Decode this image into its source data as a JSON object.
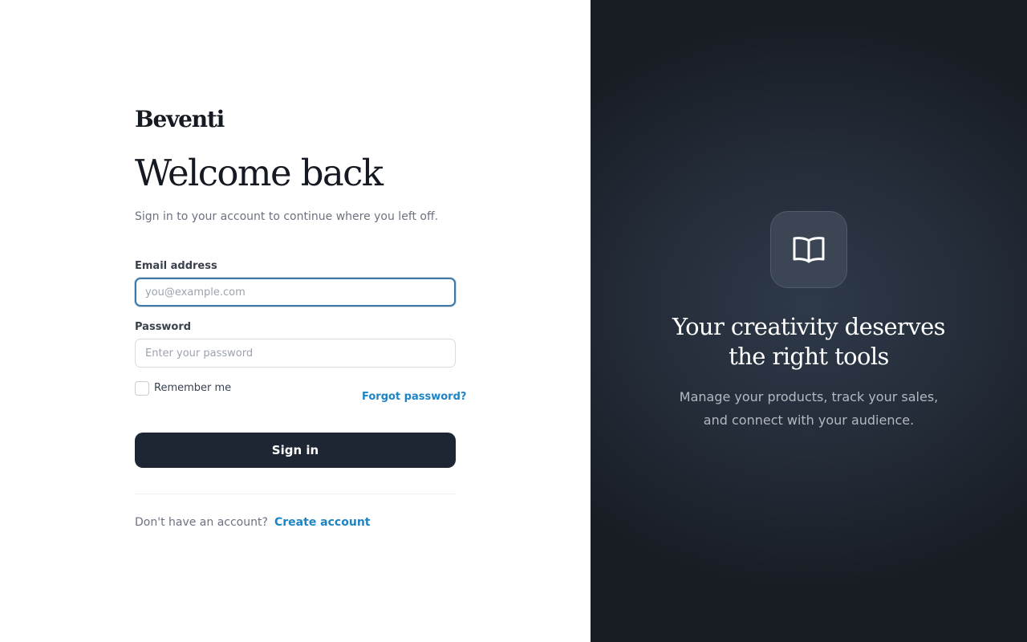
{
  "brand": {
    "logo_text": "Beventi"
  },
  "login": {
    "title": "Welcome back",
    "subtitle": "Sign in to your account to continue where you left off.",
    "email": {
      "label": "Email address",
      "placeholder": "you@example.com",
      "value": ""
    },
    "password": {
      "label": "Password",
      "placeholder": "Enter your password",
      "value": ""
    },
    "remember_label": "Remember me",
    "remember_checked": false,
    "forgot_label": "Forgot password?",
    "signin_label": "Sign in",
    "no_account_text": "Don't have an account?",
    "create_label": "Create account"
  },
  "hero": {
    "icon": "open-book-icon",
    "title_line1": "Your creativity deserves",
    "title_line2": "the right tools",
    "subtitle_line1": "Manage your products, track your sales,",
    "subtitle_line2": "and connect with your audience."
  },
  "colors": {
    "primary_button": "#1e2633",
    "link": "#1d84c6",
    "focus_border": "#3f78a4",
    "panel_dark": "#1f2630",
    "text_dark": "#151a22",
    "text_muted": "#6b7280"
  }
}
